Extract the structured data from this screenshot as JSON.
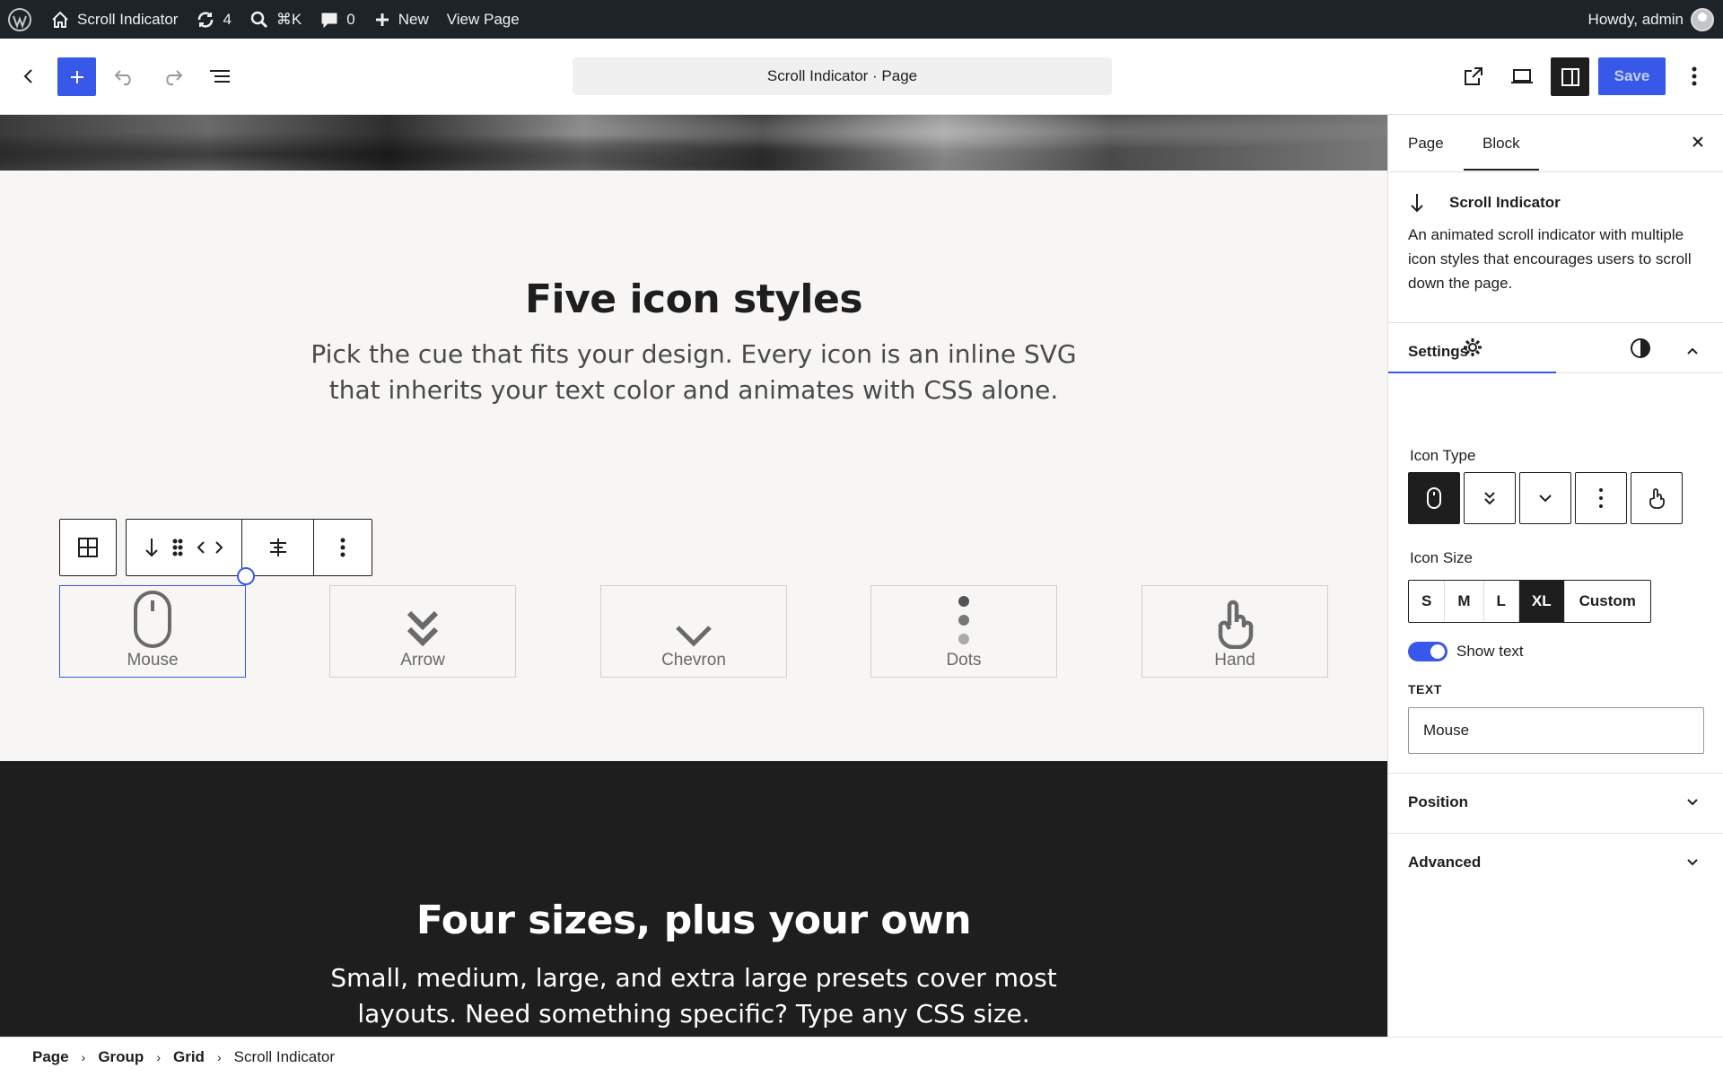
{
  "adminbar": {
    "site_name": "Scroll Indicator",
    "updates_count": "4",
    "search_shortcut": "⌘K",
    "comments_count": "0",
    "new_label": "New",
    "view_page_label": "View Page",
    "greeting": "Howdy, admin"
  },
  "header": {
    "document_title": "Scroll Indicator · Page",
    "save_label": "Save"
  },
  "canvas": {
    "section1": {
      "title": "Five icon styles",
      "subtitle": "Pick the cue that fits your design. Every icon is an inline SVG that inherits your text color and animates with CSS alone."
    },
    "icons": [
      {
        "label": "Mouse",
        "icon": "mouse-icon",
        "selected": true
      },
      {
        "label": "Arrow",
        "icon": "double-chevron-down-icon"
      },
      {
        "label": "Chevron",
        "icon": "chevron-down-icon"
      },
      {
        "label": "Dots",
        "icon": "dots-vertical-icon"
      },
      {
        "label": "Hand",
        "icon": "hand-pointer-icon"
      }
    ],
    "section2": {
      "title": "Four sizes, plus your own",
      "subtitle": "Small, medium, large, and extra large presets cover most layouts. Need something specific? Type any CSS size."
    }
  },
  "breadcrumb": [
    "Page",
    "Group",
    "Grid",
    "Scroll Indicator"
  ],
  "sidebar": {
    "tabs": [
      "Page",
      "Block"
    ],
    "active_tab": "Block",
    "block": {
      "name": "Scroll Indicator",
      "description": "An animated scroll indicator with multiple icon styles that encourages users to scroll down the page."
    },
    "settings": {
      "panel_title": "Settings",
      "icon_type_label": "Icon Type",
      "icon_types": [
        "mouse",
        "double-chevron",
        "chevron",
        "dots",
        "hand"
      ],
      "icon_type_selected": "mouse",
      "icon_size_label": "Icon Size",
      "sizes": [
        "S",
        "M",
        "L",
        "XL",
        "Custom"
      ],
      "size_selected": "XL",
      "show_text_label": "Show text",
      "show_text": true,
      "text_label": "TEXT",
      "text_value": "Mouse"
    },
    "position_title": "Position",
    "advanced_title": "Advanced"
  },
  "colors": {
    "accent": "#3858e9",
    "dark": "#1e1e1e",
    "adminbar": "#1d2327",
    "canvas": "#f7f6f4"
  }
}
